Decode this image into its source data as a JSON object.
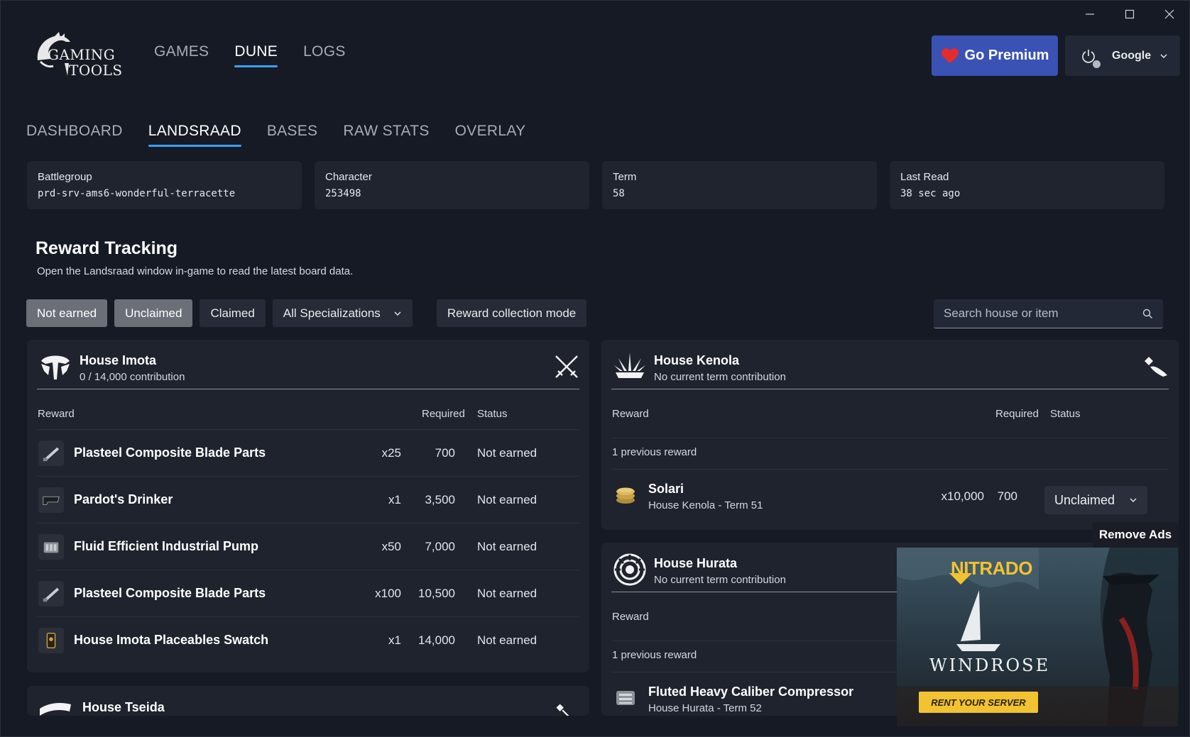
{
  "logo": {
    "line1": "GAMING",
    "line2": "TOOLS"
  },
  "top_nav": [
    {
      "label": "GAMES",
      "active": false
    },
    {
      "label": "DUNE",
      "active": true
    },
    {
      "label": "LOGS",
      "active": false
    }
  ],
  "premium_label": "Go Premium",
  "account_label": "Google",
  "sub_nav": [
    {
      "label": "DASHBOARD",
      "active": false
    },
    {
      "label": "LANDSRAAD",
      "active": true
    },
    {
      "label": "BASES",
      "active": false
    },
    {
      "label": "RAW STATS",
      "active": false
    },
    {
      "label": "OVERLAY",
      "active": false
    }
  ],
  "info": [
    {
      "label": "Battlegroup",
      "value": "prd-srv-ams6-wonderful-terracette"
    },
    {
      "label": "Character",
      "value": "253498"
    },
    {
      "label": "Term",
      "value": "58"
    },
    {
      "label": "Last Read",
      "value": "38 sec ago"
    }
  ],
  "section": {
    "title": "Reward Tracking",
    "subtitle": "Open the Landsraad window in-game to read the latest board data."
  },
  "filters": {
    "not_earned": "Not earned",
    "unclaimed": "Unclaimed",
    "claimed": "Claimed",
    "specializations": "All Specializations",
    "mode": "Reward collection mode"
  },
  "search_placeholder": "Search house or item",
  "columns": {
    "reward": "Reward",
    "required": "Required",
    "status": "Status"
  },
  "imota": {
    "name": "House Imota",
    "contribution": "0 / 14,000 contribution",
    "rows": [
      {
        "item": "Plasteel Composite Blade Parts",
        "qty": "x25",
        "req": "700",
        "status": "Not earned"
      },
      {
        "item": "Pardot's Drinker",
        "qty": "x1",
        "req": "3,500",
        "status": "Not earned"
      },
      {
        "item": "Fluid Efficient Industrial Pump",
        "qty": "x50",
        "req": "7,000",
        "status": "Not earned"
      },
      {
        "item": "Plasteel Composite Blade Parts",
        "qty": "x100",
        "req": "10,500",
        "status": "Not earned"
      },
      {
        "item": "House Imota Placeables Swatch",
        "qty": "x1",
        "req": "14,000",
        "status": "Not earned"
      }
    ]
  },
  "tseida": {
    "name": "House Tseida"
  },
  "kenola": {
    "name": "House Kenola",
    "contribution": "No current term contribution",
    "previous": "1 previous reward",
    "item": "Solari",
    "item_sub": "House Kenola - Term 51",
    "qty": "x10,000",
    "req": "700",
    "status": "Unclaimed"
  },
  "hurata": {
    "name": "House Hurata",
    "contribution": "No current term contribution",
    "previous": "1 previous reward",
    "item": "Fluted Heavy Caliber Compressor",
    "item_sub": "House Hurata - Term 52"
  },
  "ad": {
    "remove": "Remove Ads",
    "brand": "NITRADO",
    "game": "WINDROSE",
    "cta": "RENT YOUR SERVER"
  }
}
